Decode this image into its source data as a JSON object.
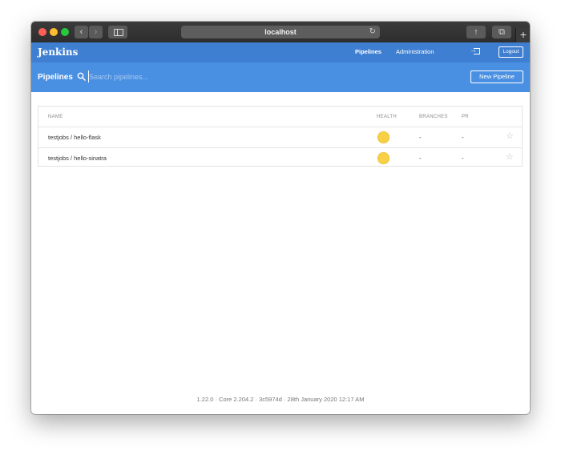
{
  "browser": {
    "url": "localhost",
    "back_glyph": "‹",
    "forward_glyph": "›",
    "reload_glyph": "↻",
    "share_glyph": "↑",
    "tabs_glyph": "⧉",
    "new_tab_glyph": "+"
  },
  "header": {
    "logo": "Jenkins",
    "nav": {
      "pipelines": "Pipelines",
      "administration": "Administration"
    },
    "logout_label": "Logout"
  },
  "subheader": {
    "title": "Pipelines",
    "search_placeholder": "Search pipelines...",
    "new_pipeline_label": "New Pipeline"
  },
  "table": {
    "columns": {
      "name": "NAME",
      "health": "HEALTH",
      "branches": "BRANCHES",
      "pr": "PR"
    },
    "rows": [
      {
        "name": "testjobs / hello-flask",
        "health": "sunny-weather-icon",
        "branches": "-",
        "pr": "-",
        "favorite_glyph": "☆"
      },
      {
        "name": "testjobs / hello-sinatra",
        "health": "sunny-weather-icon",
        "branches": "-",
        "pr": "-",
        "favorite_glyph": "☆"
      }
    ]
  },
  "footer": "1.22.0 · Core 2.204.2 · 3c5974d · 28th January 2020 12:17 AM",
  "colors": {
    "header_blue": "#3f7fd1",
    "subheader_blue": "#4a90e2",
    "sunny_yellow": "#f7d046"
  }
}
